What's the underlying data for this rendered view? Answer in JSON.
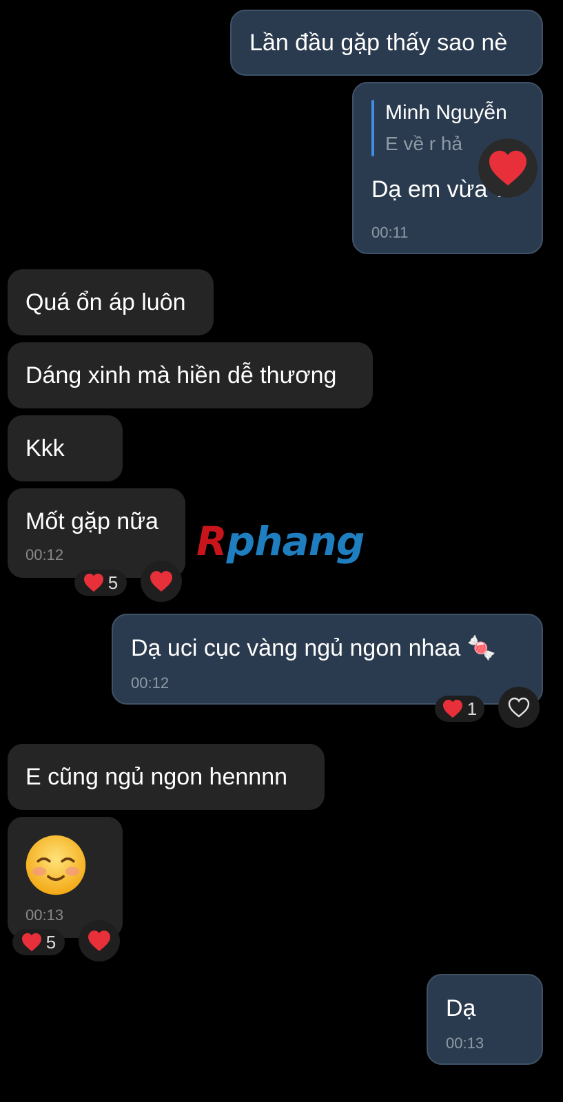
{
  "messages": [
    {
      "text": "Lần đầu gặp thấy sao nè"
    },
    {
      "reply_name": "Minh Nguyễn",
      "reply_text": "E về r hả",
      "text": "Dạ em vừa về",
      "time": "00:11"
    },
    {
      "text": "Quá ổn áp luôn"
    },
    {
      "text": "Dáng xinh mà hiền dễ thương"
    },
    {
      "text": "Kkk"
    },
    {
      "text": "Mốt gặp nữa",
      "time": "00:12",
      "reaction_count": "5"
    },
    {
      "text": "Dạ uci cục vàng ngủ ngon nhaa 🍬",
      "time": "00:12",
      "reaction_count": "1"
    },
    {
      "text": "E cũng ngủ ngon hennnn"
    },
    {
      "text": "😊",
      "time": "00:13",
      "reaction_count": "5"
    },
    {
      "text": "Dạ",
      "time": "00:13"
    }
  ],
  "watermark": {
    "first": "R",
    "rest": "phang"
  },
  "icons": {
    "reaction": "heart-icon",
    "add_reaction": "heart-outline-icon"
  },
  "colors": {
    "background": "#000000",
    "incoming_bubble": "#252525",
    "outgoing_bubble": "#2b3b4f",
    "heart": "#e8303a",
    "reply_bar": "#3f8ee6"
  }
}
